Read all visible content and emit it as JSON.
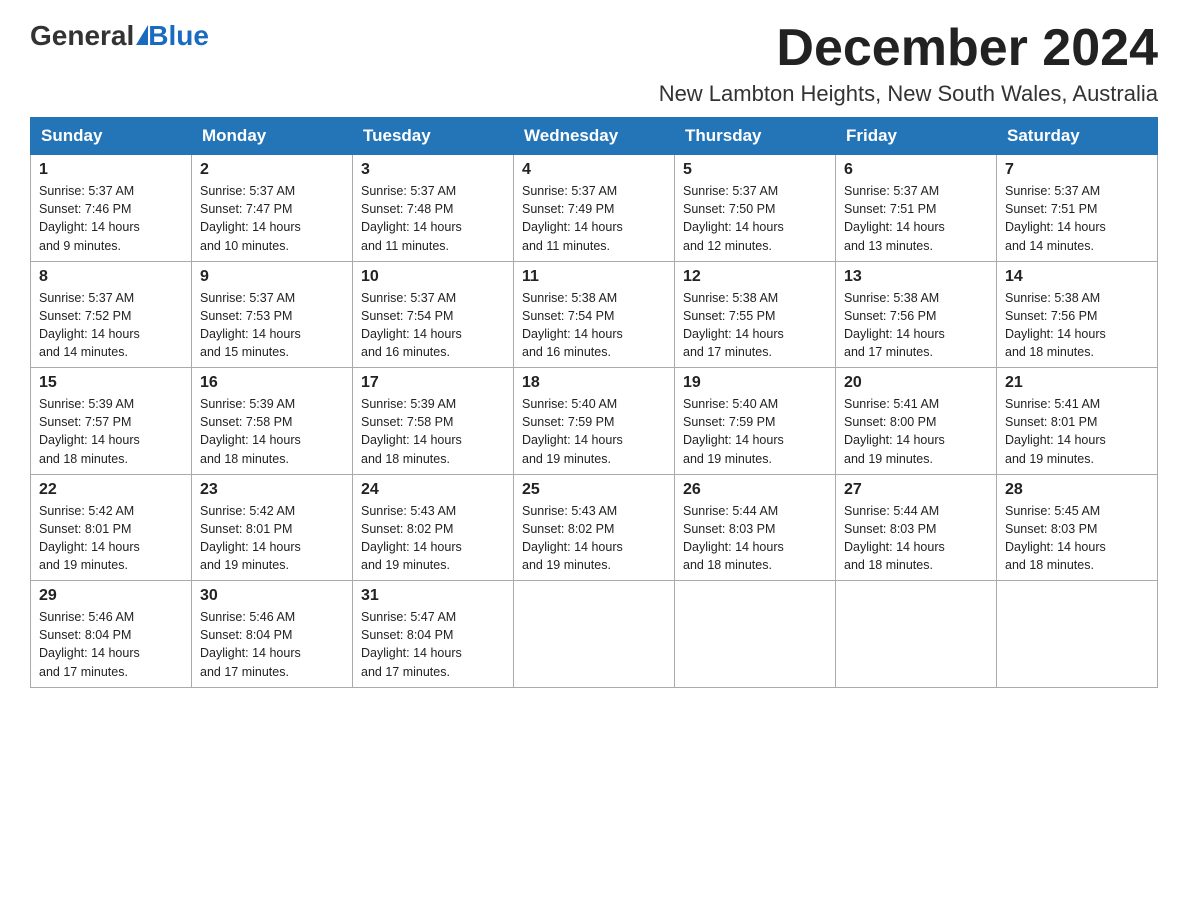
{
  "header": {
    "logo_general": "General",
    "logo_blue": "Blue",
    "month_title": "December 2024",
    "location": "New Lambton Heights, New South Wales, Australia"
  },
  "days_of_week": [
    "Sunday",
    "Monday",
    "Tuesday",
    "Wednesday",
    "Thursday",
    "Friday",
    "Saturday"
  ],
  "weeks": [
    [
      {
        "day": "1",
        "sunrise": "5:37 AM",
        "sunset": "7:46 PM",
        "daylight": "14 hours and 9 minutes."
      },
      {
        "day": "2",
        "sunrise": "5:37 AM",
        "sunset": "7:47 PM",
        "daylight": "14 hours and 10 minutes."
      },
      {
        "day": "3",
        "sunrise": "5:37 AM",
        "sunset": "7:48 PM",
        "daylight": "14 hours and 11 minutes."
      },
      {
        "day": "4",
        "sunrise": "5:37 AM",
        "sunset": "7:49 PM",
        "daylight": "14 hours and 11 minutes."
      },
      {
        "day": "5",
        "sunrise": "5:37 AM",
        "sunset": "7:50 PM",
        "daylight": "14 hours and 12 minutes."
      },
      {
        "day": "6",
        "sunrise": "5:37 AM",
        "sunset": "7:51 PM",
        "daylight": "14 hours and 13 minutes."
      },
      {
        "day": "7",
        "sunrise": "5:37 AM",
        "sunset": "7:51 PM",
        "daylight": "14 hours and 14 minutes."
      }
    ],
    [
      {
        "day": "8",
        "sunrise": "5:37 AM",
        "sunset": "7:52 PM",
        "daylight": "14 hours and 14 minutes."
      },
      {
        "day": "9",
        "sunrise": "5:37 AM",
        "sunset": "7:53 PM",
        "daylight": "14 hours and 15 minutes."
      },
      {
        "day": "10",
        "sunrise": "5:37 AM",
        "sunset": "7:54 PM",
        "daylight": "14 hours and 16 minutes."
      },
      {
        "day": "11",
        "sunrise": "5:38 AM",
        "sunset": "7:54 PM",
        "daylight": "14 hours and 16 minutes."
      },
      {
        "day": "12",
        "sunrise": "5:38 AM",
        "sunset": "7:55 PM",
        "daylight": "14 hours and 17 minutes."
      },
      {
        "day": "13",
        "sunrise": "5:38 AM",
        "sunset": "7:56 PM",
        "daylight": "14 hours and 17 minutes."
      },
      {
        "day": "14",
        "sunrise": "5:38 AM",
        "sunset": "7:56 PM",
        "daylight": "14 hours and 18 minutes."
      }
    ],
    [
      {
        "day": "15",
        "sunrise": "5:39 AM",
        "sunset": "7:57 PM",
        "daylight": "14 hours and 18 minutes."
      },
      {
        "day": "16",
        "sunrise": "5:39 AM",
        "sunset": "7:58 PM",
        "daylight": "14 hours and 18 minutes."
      },
      {
        "day": "17",
        "sunrise": "5:39 AM",
        "sunset": "7:58 PM",
        "daylight": "14 hours and 18 minutes."
      },
      {
        "day": "18",
        "sunrise": "5:40 AM",
        "sunset": "7:59 PM",
        "daylight": "14 hours and 19 minutes."
      },
      {
        "day": "19",
        "sunrise": "5:40 AM",
        "sunset": "7:59 PM",
        "daylight": "14 hours and 19 minutes."
      },
      {
        "day": "20",
        "sunrise": "5:41 AM",
        "sunset": "8:00 PM",
        "daylight": "14 hours and 19 minutes."
      },
      {
        "day": "21",
        "sunrise": "5:41 AM",
        "sunset": "8:01 PM",
        "daylight": "14 hours and 19 minutes."
      }
    ],
    [
      {
        "day": "22",
        "sunrise": "5:42 AM",
        "sunset": "8:01 PM",
        "daylight": "14 hours and 19 minutes."
      },
      {
        "day": "23",
        "sunrise": "5:42 AM",
        "sunset": "8:01 PM",
        "daylight": "14 hours and 19 minutes."
      },
      {
        "day": "24",
        "sunrise": "5:43 AM",
        "sunset": "8:02 PM",
        "daylight": "14 hours and 19 minutes."
      },
      {
        "day": "25",
        "sunrise": "5:43 AM",
        "sunset": "8:02 PM",
        "daylight": "14 hours and 19 minutes."
      },
      {
        "day": "26",
        "sunrise": "5:44 AM",
        "sunset": "8:03 PM",
        "daylight": "14 hours and 18 minutes."
      },
      {
        "day": "27",
        "sunrise": "5:44 AM",
        "sunset": "8:03 PM",
        "daylight": "14 hours and 18 minutes."
      },
      {
        "day": "28",
        "sunrise": "5:45 AM",
        "sunset": "8:03 PM",
        "daylight": "14 hours and 18 minutes."
      }
    ],
    [
      {
        "day": "29",
        "sunrise": "5:46 AM",
        "sunset": "8:04 PM",
        "daylight": "14 hours and 17 minutes."
      },
      {
        "day": "30",
        "sunrise": "5:46 AM",
        "sunset": "8:04 PM",
        "daylight": "14 hours and 17 minutes."
      },
      {
        "day": "31",
        "sunrise": "5:47 AM",
        "sunset": "8:04 PM",
        "daylight": "14 hours and 17 minutes."
      },
      null,
      null,
      null,
      null
    ]
  ],
  "labels": {
    "sunrise_prefix": "Sunrise: ",
    "sunset_prefix": "Sunset: ",
    "daylight_prefix": "Daylight: "
  }
}
